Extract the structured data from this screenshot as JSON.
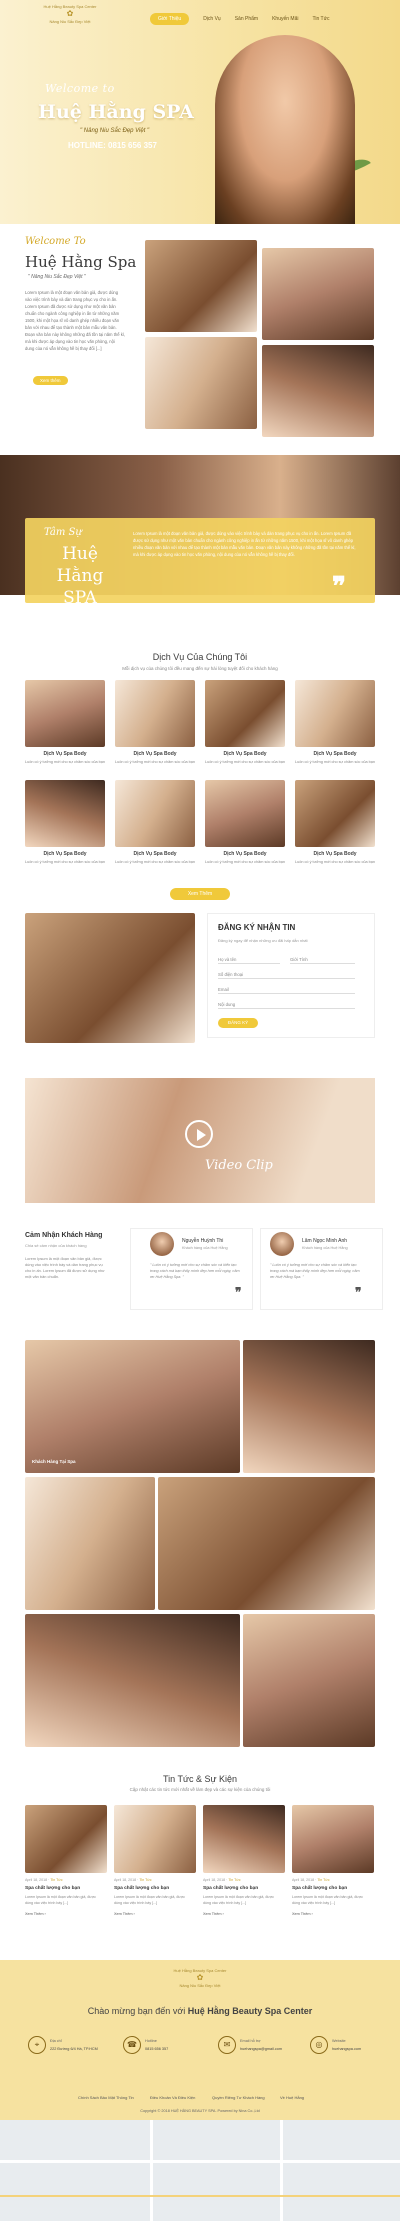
{
  "brand": {
    "line1": "Huệ Hằng Beauty Spa Center",
    "line2": "Nâng Niu Sắc Đẹp Việt"
  },
  "nav": [
    "Giới Thiệu",
    "Dịch Vụ",
    "Sản Phẩm",
    "Khuyến Mãi",
    "Tin Tức"
  ],
  "hero": {
    "welcome": "Welcome to",
    "title": "Huệ Hằng SPA",
    "tagline": "\" Nâng Niu Sắc Đẹp Việt \"",
    "hotline": "HOTLINE: 0815 656 357"
  },
  "about": {
    "welcome": "Welcome To",
    "name": "Huệ Hằng Spa",
    "quote": "\" Nâng Niu Sắc Đẹp Việt \"",
    "text": "Lorem Ipsum là một đoạn văn bản giả, được dùng vào việc trình bày và dàn trang phục vụ cho in ấn. Lorem Ipsum đã được sử dụng như một văn bản chuẩn cho ngành công nghiệp in ấn từ những năm 1500, khi một họa sĩ vô danh ghép nhiều đoạn văn bản với nhau để tạo thành một bản mẫu văn bản. Đoạn văn bản này không những đã tồn tại năm thế kỉ, mà khi được áp dụng vào tin học văn phòng, nội dung của nó vẫn không hề bị thay đổi [...]",
    "button": "Xem thêm"
  },
  "banner": {
    "sub": "Tâm Sự",
    "big1": "Huệ Hằng",
    "big2": "SPA",
    "text": "Lorem Ipsum là một đoạn văn bản giả, được dùng vào việc trình bày và dàn trang phục vụ cho in ấn. Lorem Ipsum đã được sử dụng như một văn bản chuẩn cho ngành công nghiệp in ấn từ những năm 1500, khi một họa sĩ vô danh ghép nhiều đoạn văn bản với nhau để tạo thành một bản mẫu văn bản. Đoạn văn bản này không những đã tồn tại năm thế kỉ, mà khi được áp dụng vào tin học văn phòng, nội dung của nó vẫn không hề bị thay đổi."
  },
  "services": {
    "title": "Dịch Vụ Của Chúng Tôi",
    "subtitle": "Mỗi dịch vụ của chúng tôi đều mang đến sự hài lòng tuyệt đối cho khách hàng",
    "items": [
      {
        "name": "Dịch Vụ Spa Body",
        "desc": "Luôn có ý tưởng mới cho sự chăm sóc của bạn"
      },
      {
        "name": "Dịch Vụ Spa Body",
        "desc": "Luôn có ý tưởng mới cho sự chăm sóc của bạn"
      },
      {
        "name": "Dịch Vụ Spa Body",
        "desc": "Luôn có ý tưởng mới cho sự chăm sóc của bạn"
      },
      {
        "name": "Dịch Vụ Spa Body",
        "desc": "Luôn có ý tưởng mới cho sự chăm sóc của bạn"
      },
      {
        "name": "Dịch Vụ Spa Body",
        "desc": "Luôn có ý tưởng mới cho sự chăm sóc của bạn"
      },
      {
        "name": "Dịch Vụ Spa Body",
        "desc": "Luôn có ý tưởng mới cho sự chăm sóc của bạn"
      },
      {
        "name": "Dịch Vụ Spa Body",
        "desc": "Luôn có ý tưởng mới cho sự chăm sóc của bạn"
      },
      {
        "name": "Dịch Vụ Spa Body",
        "desc": "Luôn có ý tưởng mới cho sự chăm sóc của bạn"
      }
    ],
    "button": "Xem Thêm"
  },
  "register": {
    "title": "ĐĂNG KÝ NHẬN TIN",
    "subtitle": "Đăng ký ngay để nhận những ưu đãi hấp dẫn nhất",
    "name": "Họ và tên",
    "gender": "Giới Tính",
    "phone": "Số điện thoại",
    "email": "Email",
    "note": "Nội dung",
    "button": "ĐĂNG KÝ"
  },
  "video": {
    "label": "Video Clip"
  },
  "testimonials": {
    "title": "Cảm Nhận Khách Hàng",
    "subtitle": "Chia sẻ cảm nhận của khách hàng",
    "text": "Lorem Ipsum là một đoạn văn bản giả, được dùng vào việc trình bày và dàn trang phục vụ cho in ấn. Lorem Ipsum đã được sử dụng như một văn bản chuẩn.",
    "items": [
      {
        "name": "Nguyễn Huỳnh Thi",
        "role": "Khách hàng của Huệ Hằng",
        "body": "\" Luôn có ý tưởng mới cho sự chăm sóc và kiến tạo trong cách mà bạn thấy mình đẹp hơn mỗi ngày, cảm ơn Huệ Hằng Spa. \""
      },
      {
        "name": "Lâm Ngọc Minh Anh",
        "role": "Khách hàng của Huệ Hằng",
        "body": "\" Luôn có ý tưởng mới cho sự chăm sóc và kiến tạo trong cách mà bạn thấy mình đẹp hơn mỗi ngày, cảm ơn Huệ Hằng Spa. \""
      }
    ]
  },
  "gallery": {
    "label": "Khách Hàng Tại Spa"
  },
  "news": {
    "title": "Tin Tức & Sự Kiện",
    "subtitle": "Cập nhật các tin tức mới nhất về làm đẹp và các sự kiện của chúng tôi",
    "items": [
      {
        "date": "April 18, 2018",
        "tag": "Tin Tức",
        "title": "Spa chất lượng cho bạn",
        "desc": "Lorem Ipsum là một đoạn văn bản giả, được dùng vào việc trình bày [...]",
        "more": "Xem Thêm ›"
      },
      {
        "date": "April 18, 2018",
        "tag": "Tin Tức",
        "title": "Spa chất lượng cho bạn",
        "desc": "Lorem Ipsum là một đoạn văn bản giả, được dùng vào việc trình bày [...]",
        "more": "Xem Thêm ›"
      },
      {
        "date": "April 18, 2018",
        "tag": "Tin Tức",
        "title": "Spa chất lượng cho bạn",
        "desc": "Lorem Ipsum là một đoạn văn bản giả, được dùng vào việc trình bày [...]",
        "more": "Xem Thêm ›"
      },
      {
        "date": "April 18, 2018",
        "tag": "Tin Tức",
        "title": "Spa chất lượng cho bạn",
        "desc": "Lorem Ipsum là một đoạn văn bản giả, được dùng vào việc trình bày [...]",
        "more": "Xem Thêm ›"
      }
    ]
  },
  "footer": {
    "hello_prefix": "Chào mừng bạn đến với ",
    "hello_brand": "Huệ Hằng Beauty Spa Center",
    "address_label": "Địa chỉ",
    "address": "222 Đường 6/4 Hà, TP.HCM",
    "phone_label": "Hotline",
    "phone": "0815 656 357",
    "email_label": "Email hỗ trợ",
    "email": "huehangspa@gmail.com",
    "web_label": "Website",
    "web": "huehangspa.com",
    "links": [
      "Chính Sách Bảo Mật Thông Tin",
      "Điều Khoản Và Điều Kiện",
      "Quyền Riêng Tư Khách Hàng",
      "Về Huệ Hằng"
    ],
    "copyright": "Copyright © 2018 HUỆ HẰNG BEAUTY SPA. Powered by Nina Co.,Ltd"
  },
  "colors": {
    "accent": "#f0c93a",
    "footer": "#f6e2a0"
  }
}
